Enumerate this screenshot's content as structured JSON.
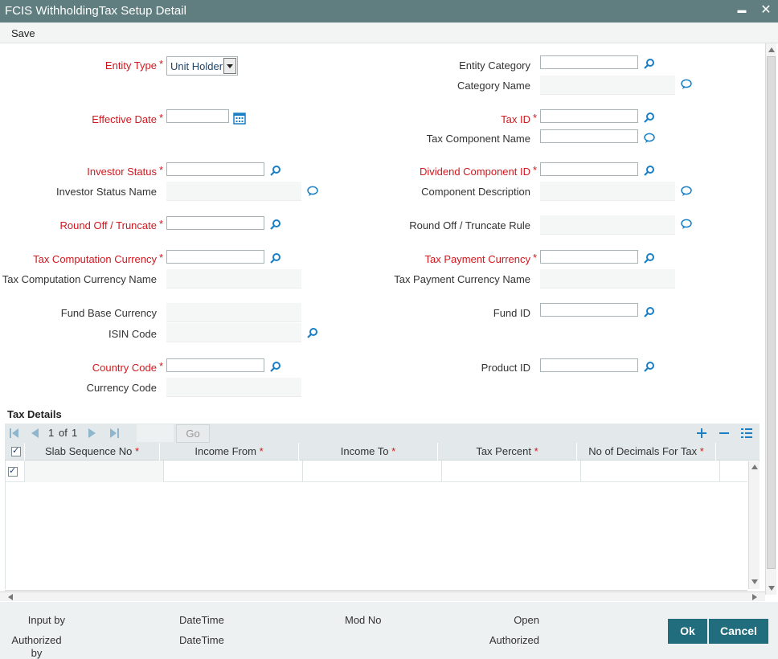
{
  "window": {
    "title": "FCIS WithholdingTax Setup Detail",
    "minimize_label": "▬",
    "close_label": "✕"
  },
  "menu": {
    "save_label": "Save"
  },
  "form": {
    "entity_type_label": "Entity Type",
    "entity_type_value": "Unit Holder",
    "entity_category_label": "Entity Category",
    "category_name_label": "Category Name",
    "effective_date_label": "Effective Date",
    "tax_id_label": "Tax ID",
    "tax_component_name_label": "Tax Component Name",
    "investor_status_label": "Investor Status",
    "investor_status_name_label": "Investor Status Name",
    "dividend_component_id_label": "Dividend Component ID",
    "component_description_label": "Component Description",
    "round_off_label": "Round Off / Truncate",
    "round_off_rule_label": "Round Off / Truncate Rule",
    "tax_computation_currency_label": "Tax Computation Currency",
    "tax_computation_currency_name_label": "Tax Computation Currency Name",
    "tax_payment_currency_label": "Tax Payment Currency",
    "tax_payment_currency_name_label": "Tax Payment Currency Name",
    "fund_base_currency_label": "Fund Base Currency",
    "isin_code_label": "ISIN Code",
    "fund_id_label": "Fund ID",
    "country_code_label": "Country Code",
    "currency_code_label": "Currency Code",
    "product_id_label": "Product ID",
    "required_mark": "*"
  },
  "tax_details": {
    "title": "Tax Details",
    "page_current": "1",
    "page_of": "of",
    "page_total": "1",
    "go_label": "Go",
    "columns": [
      "Slab Sequence No",
      "Income From",
      "Income To",
      "Tax Percent",
      "No of Decimals For Tax"
    ],
    "required_mark": "*"
  },
  "footer": {
    "input_by_label": "Input by",
    "datetime_label_1": "DateTime",
    "mod_no_label": "Mod No",
    "open_label": "Open",
    "authorized_by_label": "Authorized by",
    "datetime_label_2": "DateTime",
    "authorized_label": "Authorized",
    "ok_label": "Ok",
    "cancel_label": "Cancel"
  },
  "colors": {
    "title_bar": "#607e7f",
    "required": "#d0181e",
    "button": "#216c7d",
    "icon": "#1a7fc4"
  }
}
